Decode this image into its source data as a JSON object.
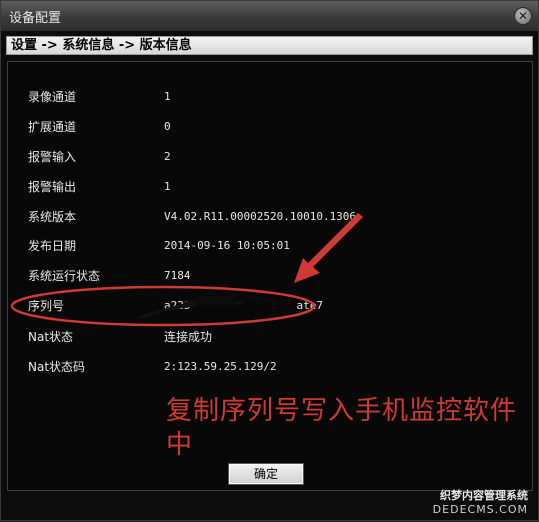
{
  "window": {
    "title": "设备配置"
  },
  "breadcrumb": "设置 -> 系统信息 -> 版本信息",
  "info_rows": [
    {
      "label": "录像通道",
      "value": "1"
    },
    {
      "label": "扩展通道",
      "value": "0"
    },
    {
      "label": "报警输入",
      "value": "2"
    },
    {
      "label": "报警输出",
      "value": "1"
    },
    {
      "label": "系统版本",
      "value": "V4.02.R11.00002520.10010.1306"
    },
    {
      "label": "发布日期",
      "value": "2014-09-16 10:05:01"
    },
    {
      "label": "系统运行状态",
      "value": "7184"
    },
    {
      "label": "序列号",
      "value": "a225                ate7"
    },
    {
      "label": "Nat状态",
      "value": "连接成功"
    },
    {
      "label": "Nat状态码",
      "value": "2:123.59.25.129/2"
    }
  ],
  "annotation": {
    "text": "复制序列号写入手机监控软件中",
    "color": "#d03a34"
  },
  "buttons": {
    "ok_label": "确定"
  },
  "watermark": {
    "cn": "织梦内容管理系统",
    "en": "DEDECMS.COM"
  },
  "icons": {
    "close": "close-icon"
  }
}
